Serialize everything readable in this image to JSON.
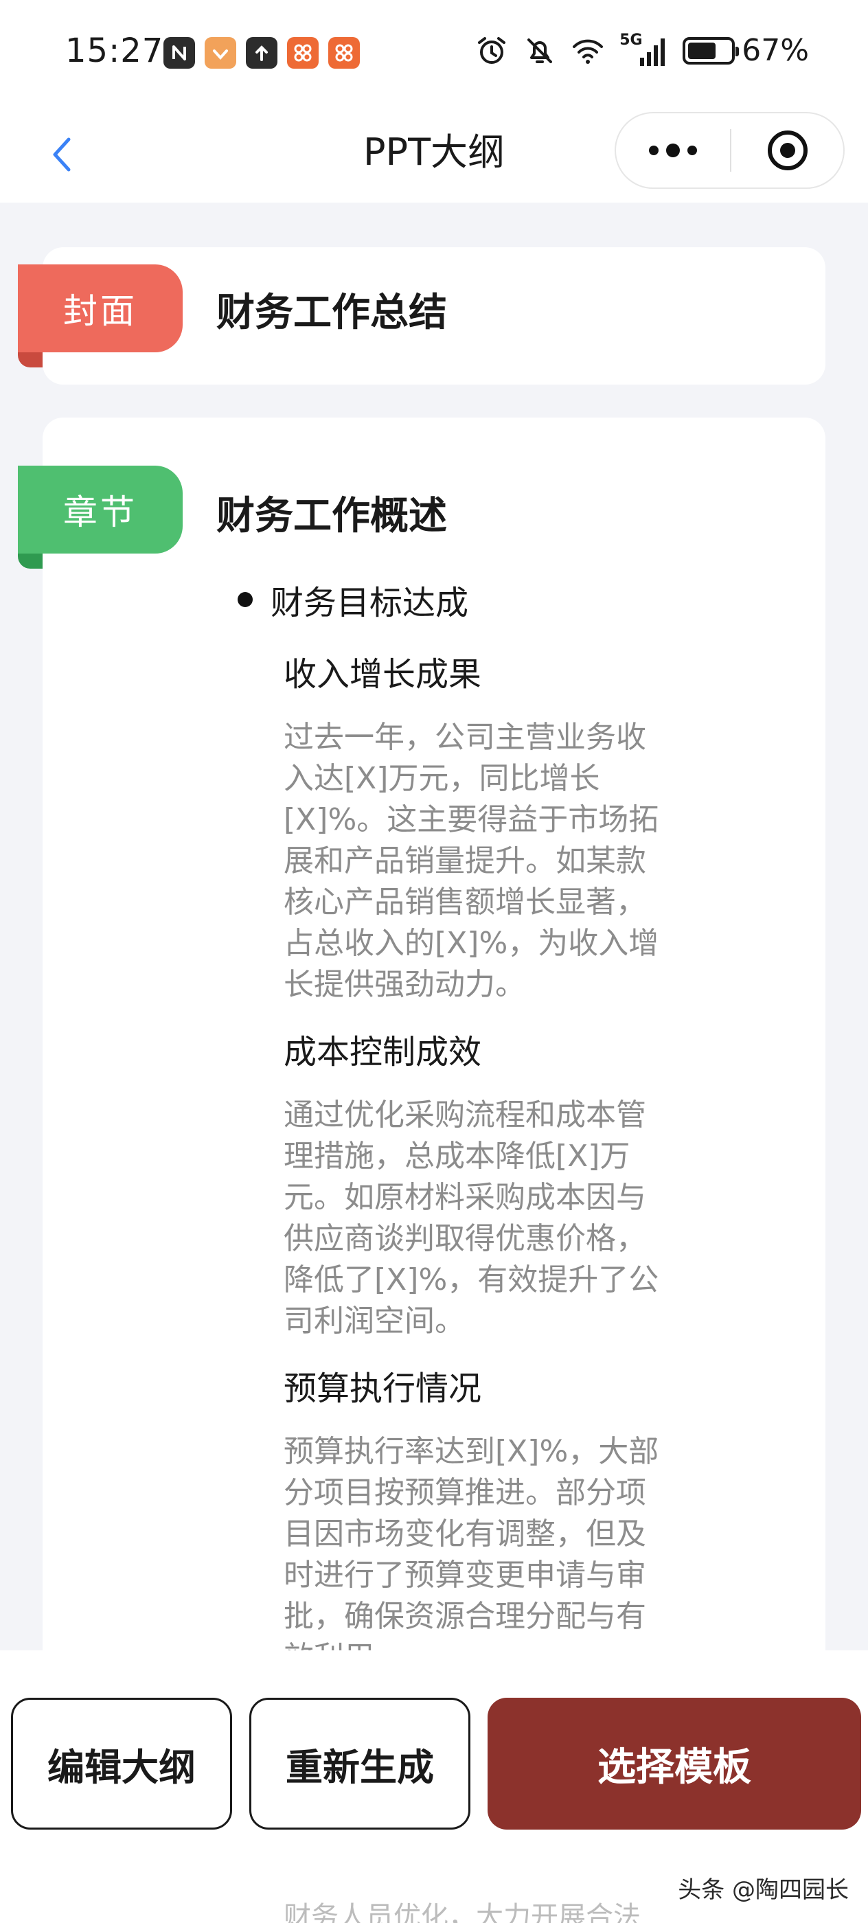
{
  "status_bar": {
    "time": "15:27",
    "battery_percent": "67%",
    "battery_level": 0.67,
    "network": "5G",
    "app_icons": [
      "nfc-icon",
      "heart-badge-icon",
      "upload-icon",
      "flower-app-icon",
      "flower-app-icon"
    ],
    "system_icons": [
      "alarm-icon",
      "mute-bell-icon",
      "wifi-icon",
      "signal-5g-icon",
      "battery-icon"
    ]
  },
  "nav": {
    "title": "PPT大纲",
    "back_icon": "chevron-left-icon",
    "accent": "#3b82f6"
  },
  "cover": {
    "tag": "封面",
    "title": "财务工作总结",
    "tag_color": "#ee6a5c"
  },
  "chapter": {
    "tag": "章节",
    "title": "财务工作概述",
    "tag_color": "#4fbf70",
    "bullet": "财务目标达成",
    "sections": [
      {
        "title": "收入增长成果",
        "lines": [
          "过去一年，公司主营业务收",
          "入达[X]万元，同比增长",
          "[X]%。这主要得益于市场拓",
          "展和产品销量提升。如某款",
          "核心产品销售额增长显著，",
          "占总收入的[X]%，为收入增",
          "长提供强劲动力。"
        ]
      },
      {
        "title": "成本控制成效",
        "lines": [
          "通过优化采购流程和成本管",
          "理措施，总成本降低[X]万",
          "元。如原材料采购成本因与",
          "供应商谈判取得优惠价格，",
          "降低了[X]%，有效提升了公",
          "司利润空间。"
        ]
      },
      {
        "title": "预算执行情况",
        "lines": [
          "预算执行率达到[X]%，大部",
          "分项目按预算推进。部分项",
          "目因市场变化有调整，但及",
          "时进行了预算变更申请与审",
          "批，确保资源合理分配与有",
          "效利用。"
        ]
      }
    ]
  },
  "actions": {
    "edit_label": "编辑大纲",
    "regenerate_label": "重新生成",
    "select_template_label": "选择模板",
    "primary_color": "#8c322c"
  },
  "peek_text": "财务人员优化，大力开展合法",
  "watermark": "头条 @陶四园长"
}
